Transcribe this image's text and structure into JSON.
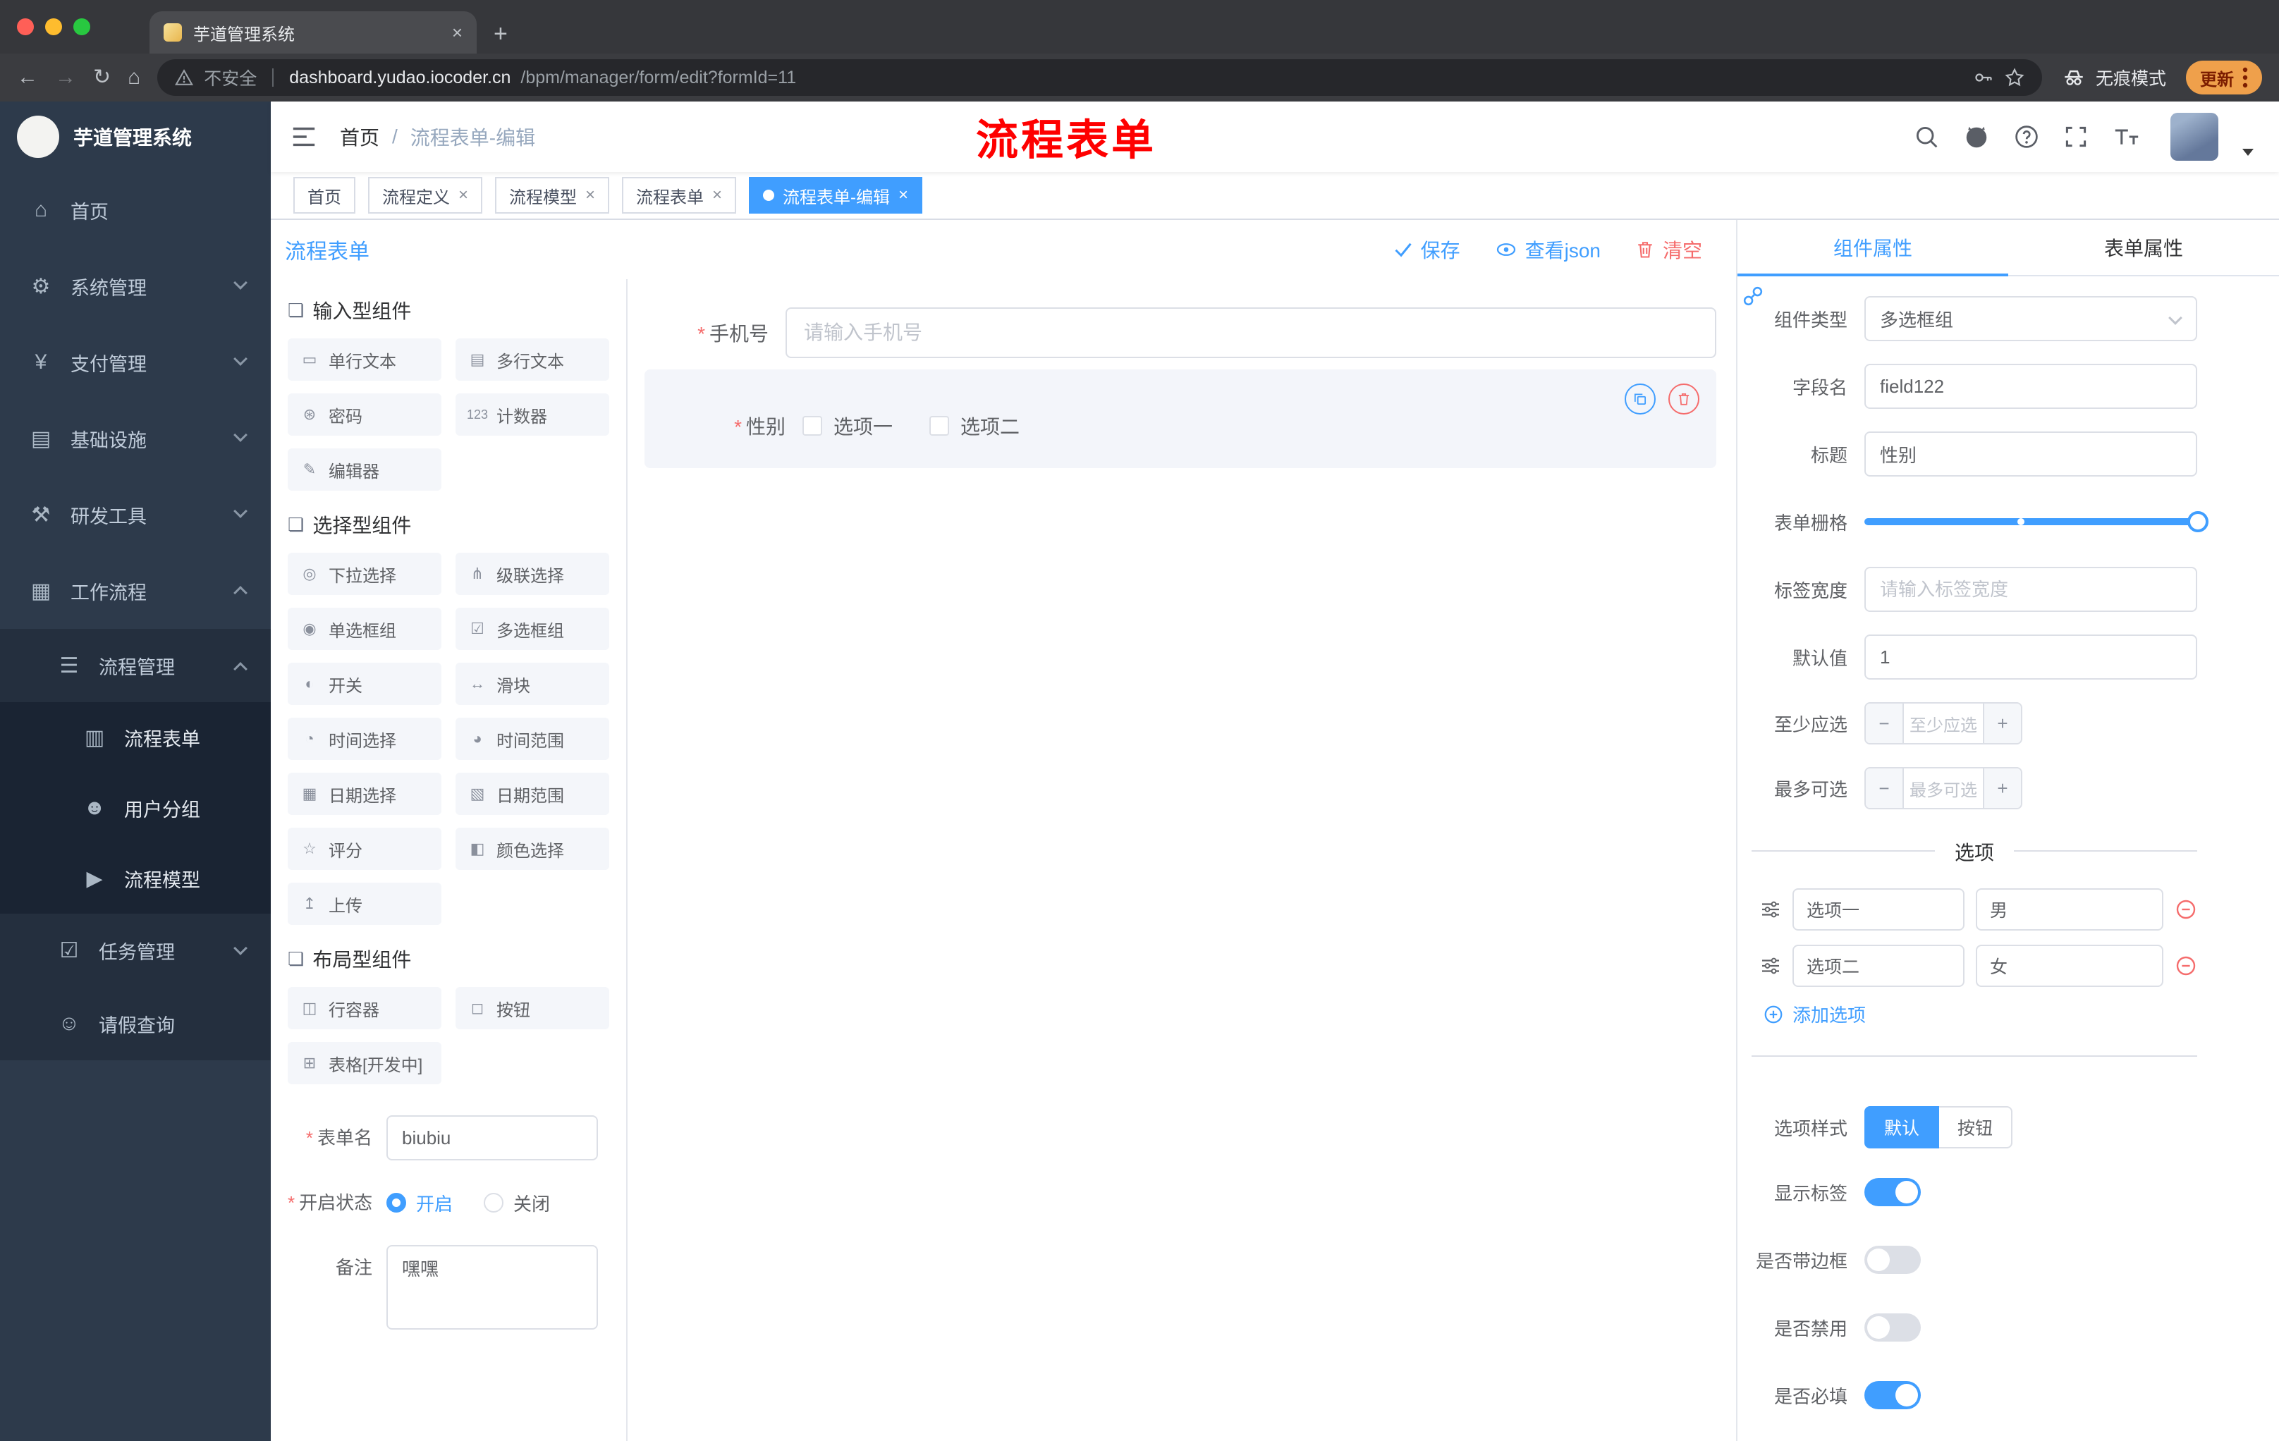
{
  "common": {
    "required_mark": "*"
  },
  "browser": {
    "tab_title": "芋道管理系统",
    "close_glyph": "×",
    "new_tab_glyph": "+",
    "nav": {
      "back": "←",
      "forward": "→",
      "reload": "↻",
      "home": "⌂"
    },
    "security_label": "不安全",
    "url_domain": "dashboard.yudao.iocoder.cn",
    "url_path": "/bpm/manager/form/edit?formId=11",
    "incognito_label": "无痕模式",
    "update_label": "更新"
  },
  "sidebar": {
    "logo_title": "芋道管理系统",
    "items": [
      {
        "label": "首页",
        "icon": "⌂"
      },
      {
        "label": "系统管理",
        "icon": "⚙"
      },
      {
        "label": "支付管理",
        "icon": "¥"
      },
      {
        "label": "基础设施",
        "icon": "▤"
      },
      {
        "label": "研发工具",
        "icon": "⚒"
      },
      {
        "label": "工作流程",
        "icon": "▦"
      },
      {
        "label": "流程管理",
        "icon": "☰"
      },
      {
        "label": "流程表单",
        "icon": "▥"
      },
      {
        "label": "用户分组",
        "icon": "☻"
      },
      {
        "label": "流程模型",
        "icon": "▶"
      },
      {
        "label": "任务管理",
        "icon": "☑"
      },
      {
        "label": "请假查询",
        "icon": "☺"
      }
    ]
  },
  "header": {
    "breadcrumb_home": "首页",
    "breadcrumb_sep": "/",
    "breadcrumb_current": "流程表单-编辑",
    "annotation": "流程表单"
  },
  "tags": {
    "close_glyph": "×",
    "items": [
      {
        "label": "首页"
      },
      {
        "label": "流程定义"
      },
      {
        "label": "流程模型"
      },
      {
        "label": "流程表单"
      },
      {
        "label": "流程表单-编辑"
      }
    ]
  },
  "designer": {
    "title": "流程表单",
    "save_label": "保存",
    "view_json_label": "查看json",
    "clear_label": "清空"
  },
  "palette": {
    "sections": [
      {
        "title": "输入型组件",
        "items": [
          {
            "label": "单行文本",
            "icon": "▭"
          },
          {
            "label": "多行文本",
            "icon": "▤"
          },
          {
            "label": "密码",
            "icon": "⊛"
          },
          {
            "label": "计数器",
            "icon": "123"
          },
          {
            "label": "编辑器",
            "icon": "✎"
          }
        ]
      },
      {
        "title": "选择型组件",
        "items": [
          {
            "label": "下拉选择",
            "icon": "◎"
          },
          {
            "label": "级联选择",
            "icon": "⋔"
          },
          {
            "label": "单选框组",
            "icon": "◉"
          },
          {
            "label": "多选框组",
            "icon": "☑"
          },
          {
            "label": "开关",
            "icon": "◐"
          },
          {
            "label": "滑块",
            "icon": "↔"
          },
          {
            "label": "时间选择",
            "icon": "◔"
          },
          {
            "label": "时间范围",
            "icon": "◕"
          },
          {
            "label": "日期选择",
            "icon": "▦"
          },
          {
            "label": "日期范围",
            "icon": "▧"
          },
          {
            "label": "评分",
            "icon": "☆"
          },
          {
            "label": "颜色选择",
            "icon": "◧"
          },
          {
            "label": "上传",
            "icon": "↥"
          }
        ]
      },
      {
        "title": "布局型组件",
        "items": [
          {
            "label": "行容器",
            "icon": "◫"
          },
          {
            "label": "按钮",
            "icon": "◻"
          },
          {
            "label": "表格[开发中]",
            "icon": "⊞"
          }
        ]
      }
    ]
  },
  "meta_form": {
    "form_name_label": "表单名",
    "form_name_value": "biubiu",
    "status_label": "开启状态",
    "status_on_label": "开启",
    "status_off_label": "关闭",
    "remark_label": "备注",
    "remark_value": "嘿嘿"
  },
  "canvas": {
    "phone_label": "手机号",
    "phone_placeholder": "请输入手机号",
    "gender_label": "性别",
    "gender_options": [
      {
        "label": "选项一"
      },
      {
        "label": "选项二"
      }
    ]
  },
  "props": {
    "tabs": {
      "component": "组件属性",
      "form": "表单属性"
    },
    "component_type_label": "组件类型",
    "component_type_value": "多选框组",
    "field_name_label": "字段名",
    "field_name_value": "field122",
    "title_label": "标题",
    "title_value": "性别",
    "grid_label": "表单栅格",
    "label_width_label": "标签宽度",
    "label_width_placeholder": "请输入标签宽度",
    "default_label": "默认值",
    "default_value": "1",
    "min_label": "至少应选",
    "min_placeholder": "至少应选",
    "max_label": "最多可选",
    "max_placeholder": "最多可选",
    "stepper_minus": "−",
    "stepper_plus": "+",
    "options_title": "选项",
    "options": [
      {
        "label": "选项一",
        "value": "男"
      },
      {
        "label": "选项二",
        "value": "女"
      }
    ],
    "add_option_label": "添加选项",
    "option_style_label": "选项样式",
    "style_default_label": "默认",
    "style_button_label": "按钮",
    "show_label_label": "显示标签",
    "border_label": "是否带边框",
    "disabled_label": "是否禁用",
    "required_label": "是否必填"
  },
  "colors": {
    "accent": "#409eff",
    "danger": "#f56c6c",
    "annotation": "#fe0000"
  }
}
